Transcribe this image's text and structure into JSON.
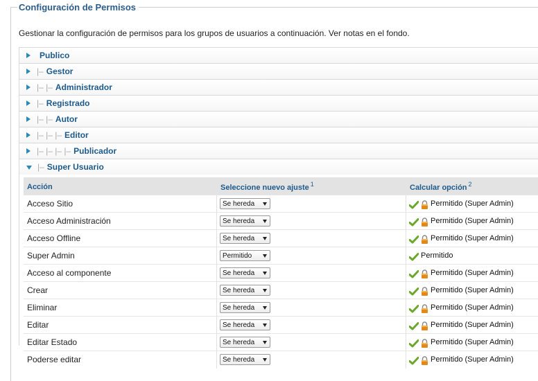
{
  "legend": "Configuración de Permisos",
  "description": "Gestionar la configuración de permisos para los grupos de usuarios a continuación. Ver notas en el fondo.",
  "groups": [
    {
      "prefix": "",
      "name": "Publico"
    },
    {
      "prefix": "|–",
      "name": "Gestor"
    },
    {
      "prefix": "|– |–",
      "name": "Administrador"
    },
    {
      "prefix": "|–",
      "name": "Registrado"
    },
    {
      "prefix": "|– |–",
      "name": "Autor"
    },
    {
      "prefix": "|– |– |–",
      "name": "Editor"
    },
    {
      "prefix": "|– |– |– |–",
      "name": "Publicador"
    },
    {
      "prefix": "|–",
      "name": "Super Usuario"
    }
  ],
  "table": {
    "headers": {
      "action": "Acción",
      "new_setting": "Seleccione nuevo ajuste",
      "new_setting_note": "1",
      "calculated": "Calcular opción",
      "calculated_note": "2"
    },
    "rows": [
      {
        "action": "Acceso Sitio",
        "setting": "Se hereda",
        "calculated": "Permitido (Super Admin)",
        "locked": true
      },
      {
        "action": "Acceso Administración",
        "setting": "Se hereda",
        "calculated": "Permitido (Super Admin)",
        "locked": true
      },
      {
        "action": "Acceso Offline",
        "setting": "Se hereda",
        "calculated": "Permitido (Super Admin)",
        "locked": true
      },
      {
        "action": "Super Admin",
        "setting": "Permitido",
        "calculated": "Permitido",
        "locked": false
      },
      {
        "action": "Acceso al componente",
        "setting": "Se hereda",
        "calculated": "Permitido (Super Admin)",
        "locked": true
      },
      {
        "action": "Crear",
        "setting": "Se hereda",
        "calculated": "Permitido (Super Admin)",
        "locked": true
      },
      {
        "action": "Eliminar",
        "setting": "Se hereda",
        "calculated": "Permitido (Super Admin)",
        "locked": true
      },
      {
        "action": "Editar",
        "setting": "Se hereda",
        "calculated": "Permitido (Super Admin)",
        "locked": true
      },
      {
        "action": "Editar Estado",
        "setting": "Se hereda",
        "calculated": "Permitido (Super Admin)",
        "locked": true
      },
      {
        "action": "Poderse editar",
        "setting": "Se hereda",
        "calculated": "Permitido (Super Admin)",
        "locked": true
      }
    ]
  },
  "colors": {
    "accent": "#1d5a8c",
    "check": "#6aa82a",
    "lock": "#e08a1e"
  },
  "icons": {
    "collapsed": "triangle-right-icon",
    "expanded": "triangle-down-icon",
    "allowed": "check-icon",
    "locked": "lock-icon"
  }
}
